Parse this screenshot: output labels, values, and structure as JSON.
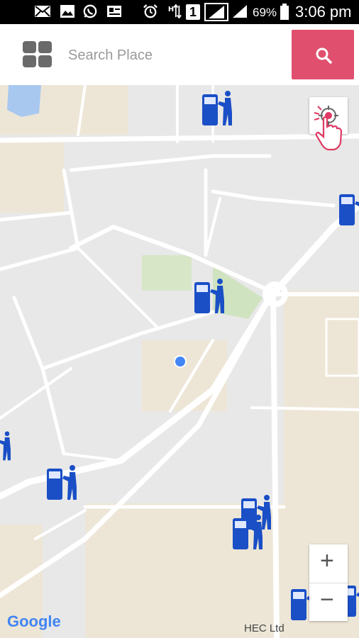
{
  "status_bar": {
    "battery": "69%",
    "time": "3:06 pm",
    "sim_slot": "1"
  },
  "search": {
    "placeholder": "Search Place",
    "value": ""
  },
  "map": {
    "place_label": "HEC Ltd",
    "attribution": "Google",
    "current_location_color": "#4285f4",
    "atm_marker_color": "#1a4fc6",
    "zoom_in_label": "+",
    "zoom_out_label": "−"
  },
  "colors": {
    "search_button": "#e0506e",
    "status_bar_bg": "#000000",
    "map_land": "#e8e8e8",
    "map_road": "#ffffff",
    "map_park": "#cfe3c0",
    "map_water": "#a8c8f0",
    "map_beige": "#ede6d6"
  },
  "icons": {
    "status": [
      "mail-icon",
      "image-icon",
      "whatsapp-icon",
      "id-card-icon",
      "alarm-icon",
      "data-arrows-icon",
      "signal-icon",
      "battery-icon"
    ],
    "menu": "grid-menu-icon",
    "search": "search-icon",
    "locate": "locate-pointer-icon",
    "atm": "atm-person-icon"
  }
}
